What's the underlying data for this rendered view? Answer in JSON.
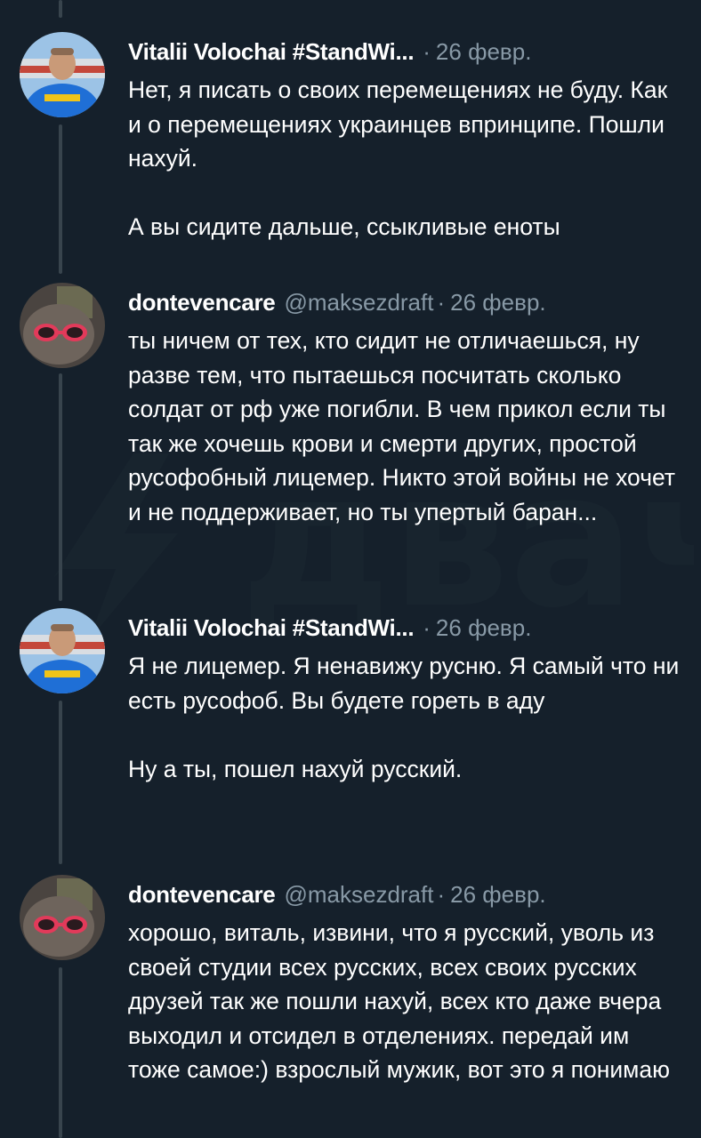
{
  "watermark": {
    "text": "двач"
  },
  "tweets": [
    {
      "author": "Vitalii Volochai #StandWi...",
      "handle": "",
      "date": "26 февр.",
      "avatar": "avatar-person-icon",
      "paragraphs": [
        "Нет, я писать о своих перемещениях не буду. Как и о перемещениях украинцев впринципе. Пошли нахуй.",
        "А вы сидите дальше, ссыкливые еноты"
      ]
    },
    {
      "author": "dontevencare",
      "handle": "@maksezdraft",
      "date": "26 февр.",
      "avatar": "avatar-cat-sunglasses-icon",
      "paragraphs": [
        "ты ничем от тех, кто сидит не отличаешься, ну разве тем, что пытаешься посчитать сколько солдат от рф уже погибли. В чем прикол если ты так же хочешь крови и смерти других, простой русофобный лицемер. Никто этой войны не хочет и не поддерживает, но ты упертый баран..."
      ]
    },
    {
      "author": "Vitalii Volochai #StandWi...",
      "handle": "",
      "date": "26 февр.",
      "avatar": "avatar-person-icon",
      "paragraphs": [
        "Я не лицемер. Я ненавижу русню. Я самый что ни есть русофоб. Вы будете гореть в аду",
        "Ну а ты, пошел нахуй русский."
      ]
    },
    {
      "author": "dontevencare",
      "handle": "@maksezdraft",
      "date": "26 февр.",
      "avatar": "avatar-cat-sunglasses-icon",
      "paragraphs": [
        "хорошо, виталь, извини, что я русский, уволь из своей студии всех русских, всех своих русских друзей так же пошли нахуй, всех кто даже вчера выходил и отсидел в отделениях. передай им тоже самое:) взрослый мужик, вот это я понимаю"
      ]
    }
  ]
}
